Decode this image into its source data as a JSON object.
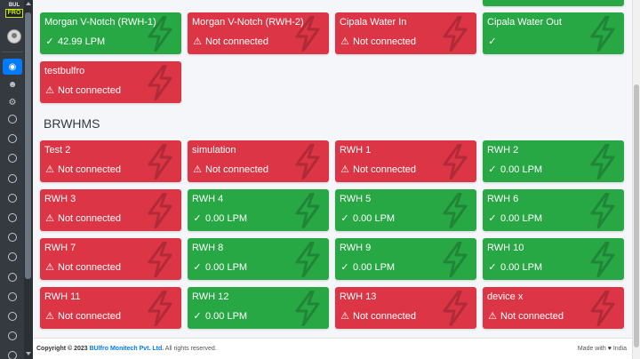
{
  "sidebar": {
    "logo_top": "BUL",
    "logo_bottom": "FRO",
    "nav_icons": [
      "dashboard-icon",
      "user-icon",
      "gears-icon"
    ],
    "circle_count": 13
  },
  "top_cards": [
    {
      "title": "Morgan V-Notch (RWH-1)",
      "status": "42.99 LPM",
      "state": "ok"
    },
    {
      "title": "Morgan V-Notch (RWH-2)",
      "status": "Not connected",
      "state": "error"
    },
    {
      "title": "Cipala Water In",
      "status": "Not connected",
      "state": "error"
    },
    {
      "title": "Cipala Water Out",
      "status": "",
      "state": "ok"
    },
    {
      "title": "testbulfro",
      "status": "Not connected",
      "state": "error"
    }
  ],
  "section": {
    "title": "BRWHMS"
  },
  "brwhms_cards": [
    {
      "title": "Test 2",
      "status": "Not connected",
      "state": "error"
    },
    {
      "title": "simulation",
      "status": "Not connected",
      "state": "error"
    },
    {
      "title": "RWH 1",
      "status": "Not connected",
      "state": "error"
    },
    {
      "title": "RWH 2",
      "status": "0.00 LPM",
      "state": "ok"
    },
    {
      "title": "RWH 3",
      "status": "Not connected",
      "state": "error"
    },
    {
      "title": "RWH 4",
      "status": "0.00 LPM",
      "state": "ok"
    },
    {
      "title": "RWH 5",
      "status": "0.00 LPM",
      "state": "ok"
    },
    {
      "title": "RWH 6",
      "status": "0.00 LPM",
      "state": "ok"
    },
    {
      "title": "RWH 7",
      "status": "Not connected",
      "state": "error"
    },
    {
      "title": "RWH 8",
      "status": "0.00 LPM",
      "state": "ok"
    },
    {
      "title": "RWH 9",
      "status": "0.00 LPM",
      "state": "ok"
    },
    {
      "title": "RWH 10",
      "status": "0.00 LPM",
      "state": "ok"
    },
    {
      "title": "RWH 11",
      "status": "Not connected",
      "state": "error"
    },
    {
      "title": "RWH 12",
      "status": "0.00 LPM",
      "state": "ok"
    },
    {
      "title": "RWH 13",
      "status": "Not connected",
      "state": "error"
    },
    {
      "title": "device x",
      "status": "Not connected",
      "state": "error"
    }
  ],
  "footer": {
    "copyright_prefix": "Copyright © 2023",
    "company": "BUlfro Monitech Pvt. Ltd.",
    "rights": "All rights reserved.",
    "made_with": "Made with",
    "made_in": "India"
  },
  "colors": {
    "ok": "#28a745",
    "error": "#dc3545",
    "sidebar": "#343a40",
    "active": "#007bff"
  }
}
